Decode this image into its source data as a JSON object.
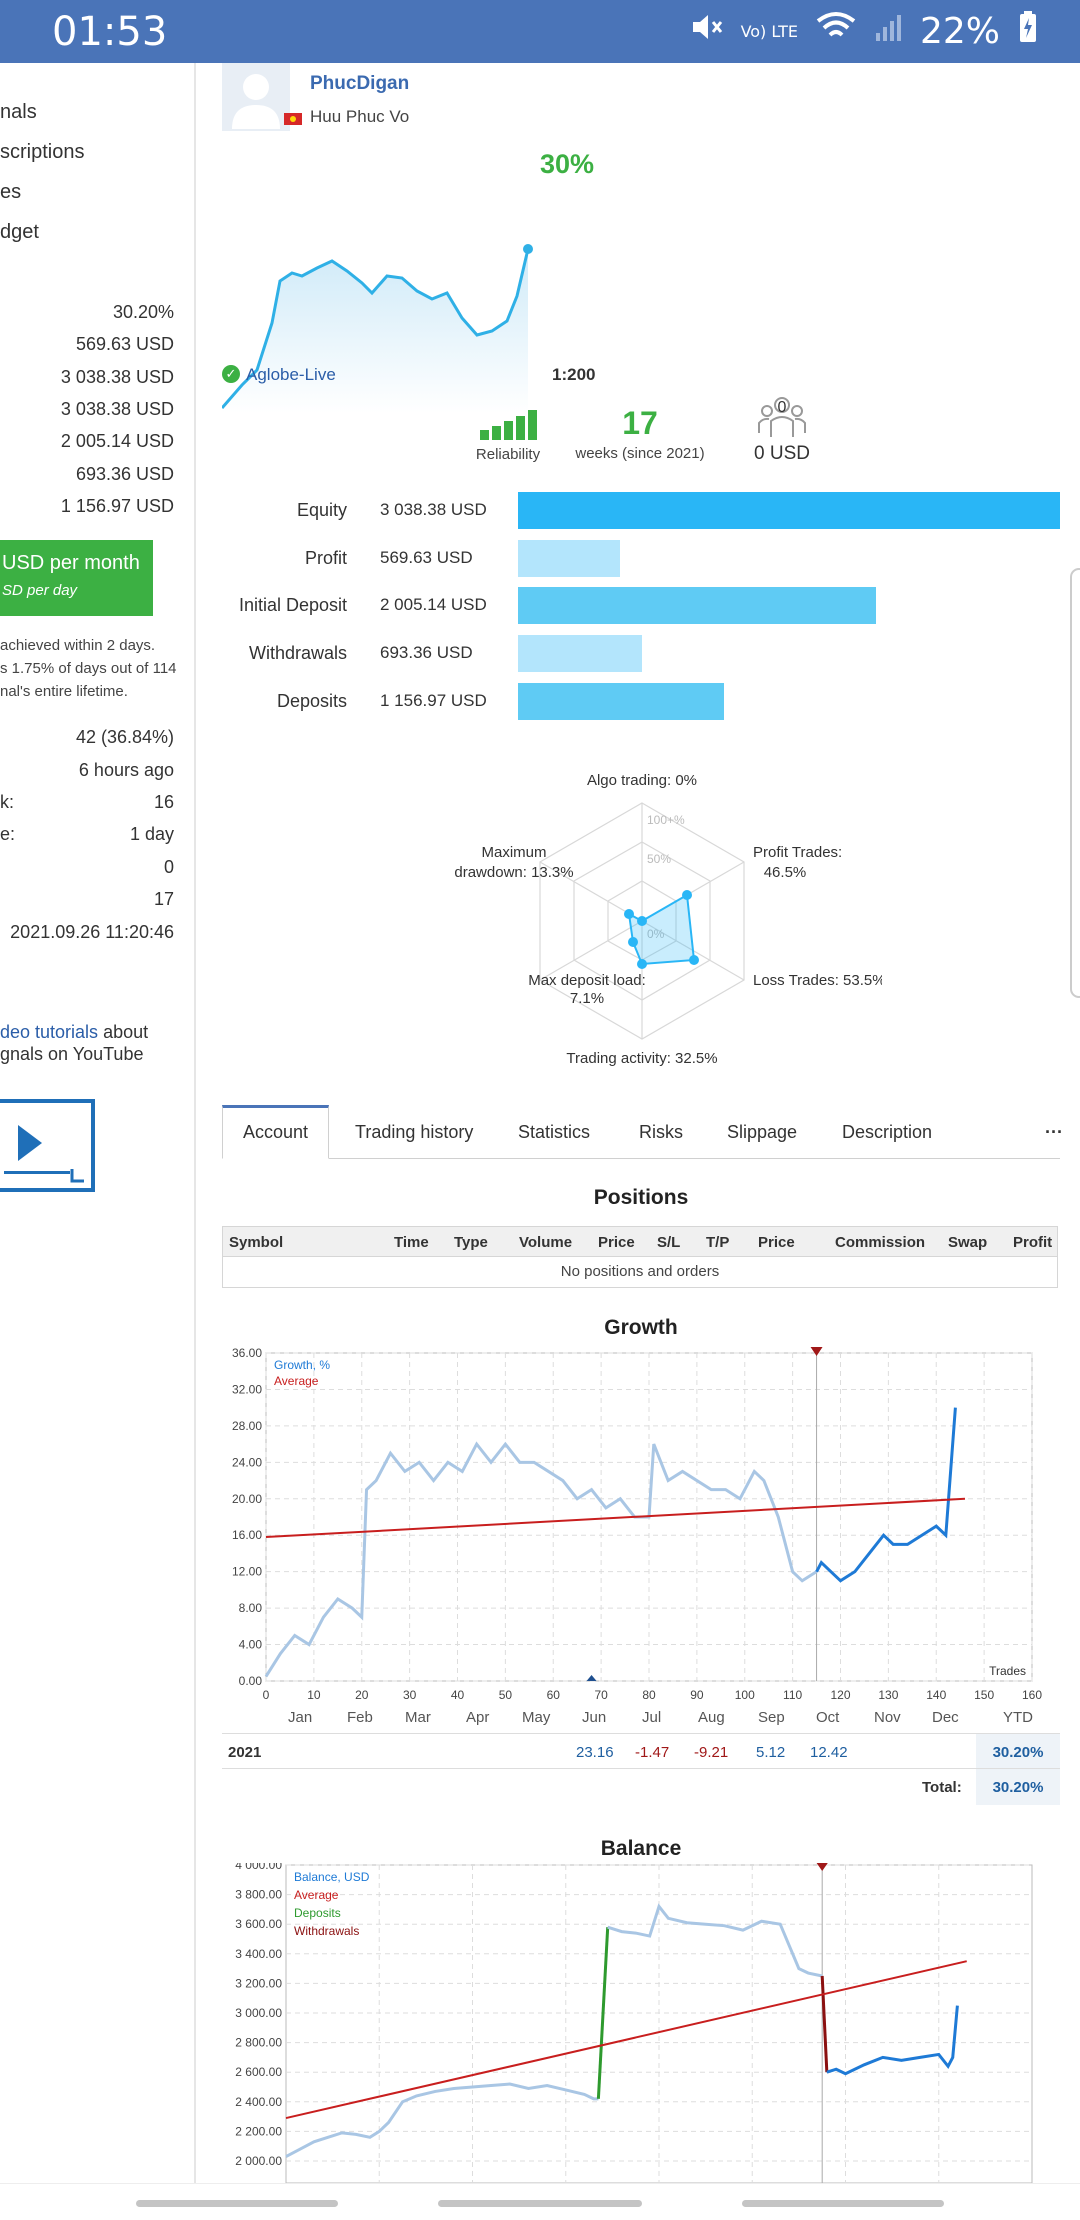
{
  "status_bar": {
    "time": "01:53",
    "network": "Vo) LTE",
    "battery": "22%"
  },
  "sidebar": {
    "menu": [
      "nals",
      "scriptions",
      "es",
      "dget"
    ],
    "values": [
      "30.20%",
      "569.63 USD",
      "3 038.38 USD",
      "3 038.38 USD",
      "2 005.14 USD",
      "693.36 USD",
      "1 156.97 USD"
    ],
    "price_label": "USD per month",
    "price_sub": "SD per day",
    "note_lines": [
      "achieved within 2 days.",
      "s 1.75% of days out of 114",
      "nal's entire lifetime."
    ],
    "stats_rows": [
      {
        "label": "",
        "value": "42 (36.84%)"
      },
      {
        "label": "",
        "value": "6 hours ago"
      },
      {
        "label": "k:",
        "value": "16"
      },
      {
        "label": "e:",
        "value": "1 day"
      },
      {
        "label": "",
        "value": "0"
      },
      {
        "label": "",
        "value": "17"
      },
      {
        "label": "",
        "value": "2021.09.26 11:20:46"
      }
    ],
    "video_link": "deo tutorials",
    "video_text_1": " about",
    "video_text_2": "gnals on YouTube"
  },
  "profile": {
    "nickname": "PhucDigan",
    "real_name": "Huu Phuc Vo",
    "growth_pct": "30%",
    "broker": "Aglobe-Live",
    "leverage": "1:200",
    "reliability_label": "Reliability",
    "weeks": "17",
    "weeks_label": "weeks (since 2021)",
    "subscribers": "0",
    "subscribers_usd": "0 USD"
  },
  "summary_bars": [
    {
      "label": "Equity",
      "value": "3 038.38 USD",
      "amount": 3038.38,
      "color": "#29b6f6"
    },
    {
      "label": "Profit",
      "value": "569.63 USD",
      "amount": 569.63,
      "color": "#b3e5fc"
    },
    {
      "label": "Initial Deposit",
      "value": "2 005.14 USD",
      "amount": 2005.14,
      "color": "#5fcbf4"
    },
    {
      "label": "Withdrawals",
      "value": "693.36 USD",
      "amount": 693.36,
      "color": "#b3e5fc"
    },
    {
      "label": "Deposits",
      "value": "1 156.97 USD",
      "amount": 1156.97,
      "color": "#5fcbf4"
    }
  ],
  "radar": {
    "labels": {
      "algo": "Algo trading: 0%",
      "profit": "Profit Trades:",
      "profit2": "46.5%",
      "loss": "Loss Trades: 53.5%",
      "activity": "Trading activity: 32.5%",
      "load": "Max deposit load:",
      "load2": "7.1%",
      "dd": "Maximum",
      "dd2": "drawdown: 13.3%"
    },
    "ring_labels": [
      "100+%",
      "50%",
      "0%"
    ],
    "values": [
      0,
      46.5,
      53.5,
      32.5,
      7.1,
      13.3
    ]
  },
  "tabs": [
    "Account",
    "Trading history",
    "Statistics",
    "Risks",
    "Slippage",
    "Description"
  ],
  "more": "···",
  "positions": {
    "title": "Positions",
    "columns": [
      "Symbol",
      "Time",
      "Type",
      "Volume",
      "Price",
      "S/L",
      "T/P",
      "Price",
      "Commission",
      "Swap",
      "Profit"
    ],
    "empty": "No positions and orders"
  },
  "growth": {
    "title": "Growth",
    "legend_growth": "Growth, %",
    "legend_avg": "Average",
    "corner": "Trades",
    "y_ticks": [
      "36.00",
      "32.00",
      "28.00",
      "24.00",
      "20.00",
      "16.00",
      "12.00",
      "8.00",
      "4.00",
      "0.00"
    ],
    "x_ticks": [
      "0",
      "10",
      "20",
      "30",
      "40",
      "50",
      "60",
      "70",
      "80",
      "90",
      "100",
      "110",
      "120",
      "130",
      "140",
      "150",
      "160"
    ]
  },
  "monthly": {
    "months": [
      "Jan",
      "Feb",
      "Mar",
      "Apr",
      "May",
      "Jun",
      "Jul",
      "Aug",
      "Sep",
      "Oct",
      "Nov",
      "Dec",
      "YTD"
    ],
    "year": "2021",
    "values": {
      "Jun": "23.16",
      "Jul": "-1.47",
      "Aug": "-9.21",
      "Sep": "5.12",
      "Oct": "12.42"
    },
    "ytd": "30.20%",
    "total_label": "Total:",
    "total": "30.20%"
  },
  "balance": {
    "title": "Balance",
    "legend": [
      "Balance, USD",
      "Average",
      "Deposits",
      "Withdrawals"
    ],
    "y_ticks": [
      "4 000.00",
      "3 800.00",
      "3 600.00",
      "3 400.00",
      "3 200.00",
      "3 000.00",
      "2 800.00",
      "2 600.00",
      "2 400.00",
      "2 200.00",
      "2 000.00"
    ]
  },
  "chart_data": [
    {
      "type": "line",
      "title": "Growth",
      "xlabel": "Trades",
      "ylabel": "",
      "xlim": [
        0,
        160
      ],
      "ylim": [
        0,
        36
      ],
      "series": [
        {
          "name": "Growth, %",
          "x": [
            0,
            3,
            6,
            9,
            12,
            15,
            18,
            20,
            21,
            23,
            26,
            29,
            32,
            35,
            38,
            41,
            44,
            47,
            50,
            53,
            56,
            59,
            62,
            65,
            68,
            71,
            74,
            77,
            80,
            81,
            84,
            87,
            90,
            93,
            96,
            99,
            102,
            104,
            107,
            110,
            112,
            115,
            116,
            118,
            120,
            123,
            126,
            129,
            131,
            134,
            137,
            140,
            142,
            144
          ],
          "y": [
            0.5,
            3,
            5,
            4,
            7,
            9,
            8,
            7,
            21,
            22,
            25,
            23,
            24,
            22,
            24,
            23,
            26,
            24,
            26,
            24,
            24,
            23,
            22,
            20,
            21,
            19,
            20,
            18,
            18,
            26,
            22,
            23,
            22,
            21,
            21,
            20,
            23,
            22,
            18,
            12,
            11,
            12,
            13,
            12,
            11,
            12,
            14,
            16,
            15,
            15,
            16,
            17,
            16,
            30
          ]
        },
        {
          "name": "Average",
          "x": [
            0,
            146
          ],
          "y": [
            15.8,
            20
          ]
        }
      ]
    },
    {
      "type": "line",
      "title": "Balance",
      "ylabel": "",
      "ylim": [
        2000,
        4000
      ],
      "series": [
        {
          "name": "Balance, USD",
          "x": [
            0,
            3,
            6,
            9,
            12,
            15,
            18,
            20,
            22,
            25,
            28,
            32,
            36,
            40,
            44,
            48,
            52,
            56,
            60,
            64,
            66,
            67,
            69,
            72,
            75,
            78,
            80,
            82,
            86,
            90,
            94,
            98,
            102,
            106,
            110,
            112,
            115,
            116,
            118,
            120,
            124,
            128,
            132,
            136,
            140,
            142,
            143,
            144
          ],
          "y": [
            2030,
            2080,
            2130,
            2160,
            2190,
            2180,
            2160,
            2200,
            2260,
            2400,
            2440,
            2470,
            2490,
            2500,
            2510,
            2520,
            2490,
            2510,
            2480,
            2450,
            2420,
            2420,
            3580,
            3550,
            3540,
            3520,
            3720,
            3640,
            3610,
            3600,
            3590,
            3560,
            3620,
            3600,
            3300,
            3270,
            3250,
            2600,
            2620,
            2590,
            2650,
            2700,
            2680,
            2700,
            2720,
            2640,
            2700,
            3050
          ]
        },
        {
          "name": "Average",
          "x": [
            0,
            146
          ],
          "y": [
            2290,
            3350
          ]
        }
      ]
    }
  ]
}
